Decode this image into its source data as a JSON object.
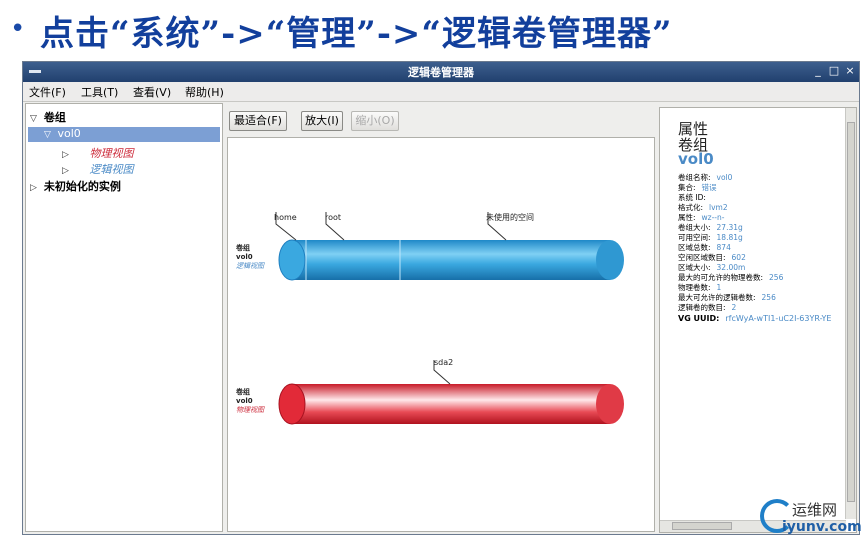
{
  "slide": {
    "bullet": "•",
    "title": "点击“系统”->“管理”->“逻辑卷管理器”"
  },
  "window": {
    "title": "逻辑卷管理器",
    "controls": [
      "_",
      "□",
      "×"
    ]
  },
  "menu": [
    "文件(F)",
    "工具(T)",
    "查看(V)",
    "帮助(H)"
  ],
  "tree": {
    "vg_group": "卷组",
    "vol0": "vol0",
    "physical_view": "物理视图",
    "logical_view": "逻辑视图",
    "uninitialized": "未初始化的实例"
  },
  "toolbar": {
    "best_fit": "最适合(F)",
    "zoom_in": "放大(I)",
    "zoom_out": "缩小(O)"
  },
  "canvas": {
    "logical": {
      "labels": [
        "卷组",
        "vol0",
        "逻辑视图"
      ],
      "segments": [
        "home",
        "root",
        "未使用的空间"
      ]
    },
    "physical": {
      "labels": [
        "卷组",
        "vol0",
        "物理视图"
      ],
      "segments": [
        "sda2"
      ]
    }
  },
  "properties": {
    "heading": "属性",
    "subheading": "卷组",
    "name": "vol0",
    "rows": [
      {
        "label": "卷组名称:",
        "value": "vol0"
      },
      {
        "label": "集合:",
        "value": "错误"
      },
      {
        "label": "系统 ID:",
        "value": ""
      },
      {
        "label": "格式化:",
        "value": "lvm2"
      },
      {
        "label": "属性:",
        "value": "wz--n-"
      },
      {
        "label": "卷组大小:",
        "value": "27.31g"
      },
      {
        "label": "可用空间:",
        "value": "18.81g"
      },
      {
        "label": "区域总数:",
        "value": "874"
      },
      {
        "label": "空闲区域数目:",
        "value": "602"
      },
      {
        "label": "区域大小:",
        "value": "32.00m"
      },
      {
        "label": "最大的可允许的物理卷数:",
        "value": "256"
      },
      {
        "label": "物理卷数:",
        "value": "1"
      },
      {
        "label": "最大可允许的逻辑卷数:",
        "value": "256"
      },
      {
        "label": "逻辑卷的数目:",
        "value": "2"
      },
      {
        "label": "VG UUID:",
        "value": "rfcWyA-wTI1-uC2I-63YR-YE"
      }
    ]
  },
  "watermark": {
    "cn": "运维网",
    "en": "iyunv.com"
  },
  "colors": {
    "title_blue": "#123f9c",
    "logical_cylinder": "#3aa8e0",
    "physical_cylinder": "#e22a38",
    "selection": "#7c9fd4",
    "link_blue": "#4a8ac6",
    "physical_label": "#cc2a3a"
  }
}
